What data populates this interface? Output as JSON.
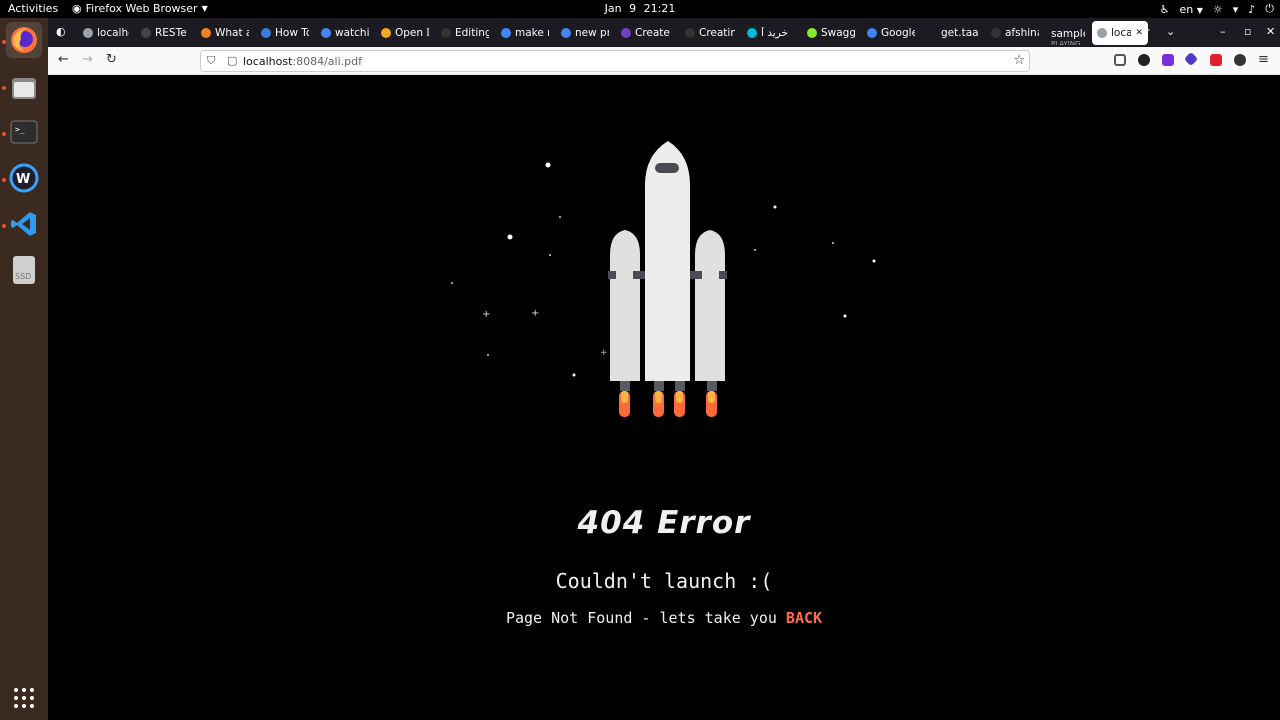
{
  "topbar": {
    "activities": "Activities",
    "app_menu": "Firefox Web Browser",
    "date": "Jan 9",
    "time": "21:21",
    "language": "en"
  },
  "tabs": [
    {
      "label": "localhost:",
      "color": "#9aa0a6"
    },
    {
      "label": "RESTe",
      "color": "#444444"
    },
    {
      "label": "What a",
      "color": "#f48024"
    },
    {
      "label": "How To",
      "color": "#3b7bd8"
    },
    {
      "label": "watchi",
      "color": "#4285f4"
    },
    {
      "label": "Open D",
      "color": "#f5a623"
    },
    {
      "label": "Editing",
      "color": "#333333"
    },
    {
      "label": "make n",
      "color": "#4285f4"
    },
    {
      "label": "new pr",
      "color": "#4285f4"
    },
    {
      "label": "Create",
      "color": "#6f42c1"
    },
    {
      "label": "Creating y",
      "color": "#333333"
    },
    {
      "label": "خرید آ",
      "color": "#00bcd4"
    },
    {
      "label": "Swagg",
      "color": "#85ea2d"
    },
    {
      "label": "Google",
      "color": "#4285f4"
    },
    {
      "label": "get.taagh",
      "color": "#1c1b22"
    },
    {
      "label": "afshina",
      "color": "#333333"
    },
    {
      "label": "sample",
      "sublabel": "PLAYING",
      "color": "#1c1b22"
    },
    {
      "label": "localhos",
      "color": "#9aa0a6",
      "active": true
    }
  ],
  "navbar": {
    "url_host": "localhost",
    "url_path": ":8084/ali.pdf"
  },
  "content": {
    "title": "404 Error",
    "subtitle": "Couldn't launch :(",
    "message": "Page Not Found - lets take you",
    "back_link": "BACK"
  },
  "colors": {
    "accent": "#ff6b4a",
    "page_background": "#000000",
    "dock_background": "#3b2a20",
    "tabstrip_background": "#1c1b22"
  }
}
